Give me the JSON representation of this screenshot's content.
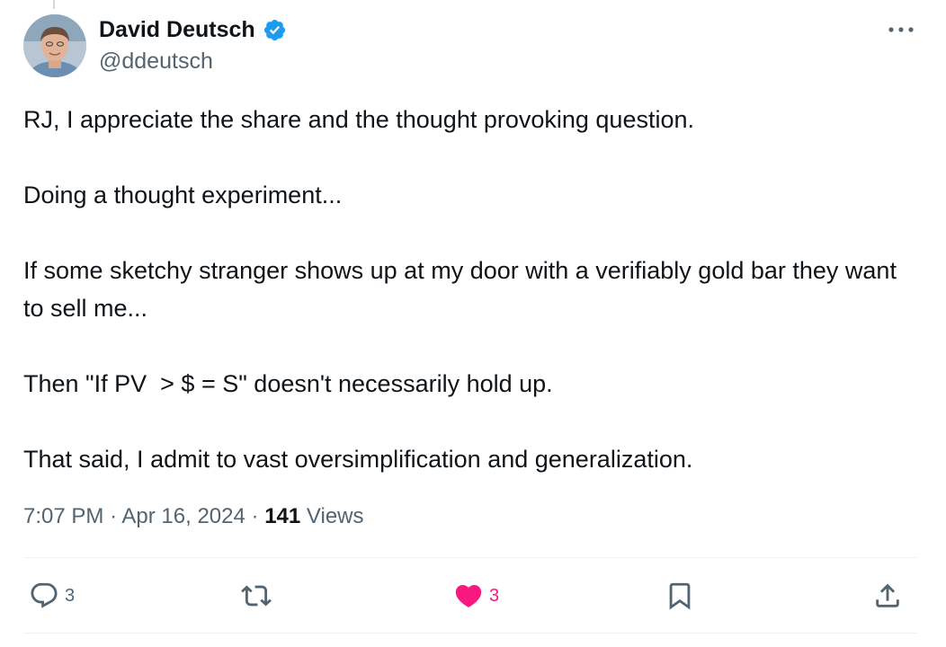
{
  "author": {
    "display_name": "David Deutsch",
    "handle": "@ddeutsch",
    "verified": true
  },
  "tweet": {
    "paragraphs": [
      "RJ, I appreciate the share and the thought provoking question.",
      "Doing a thought experiment...",
      "If some sketchy stranger shows up at my door with a verifiably gold bar they want to sell me...",
      "Then \"If PV  > $ = S\" doesn't necessarily hold up.",
      "That said, I admit to vast oversimplification and generalization."
    ],
    "time": "7:07 PM",
    "separator": "·",
    "date": "Apr 16, 2024",
    "views_count": "141",
    "views_label": "Views"
  },
  "actions": {
    "reply_count": "3",
    "retweet_count": "",
    "like_count": "3",
    "liked": true
  },
  "icons": {
    "verified": "verified-badge-icon",
    "more": "more-options-icon",
    "reply": "reply-icon",
    "retweet": "retweet-icon",
    "like": "heart-icon",
    "bookmark": "bookmark-icon",
    "share": "share-icon"
  },
  "colors": {
    "text_primary": "#0f1419",
    "text_secondary": "#536471",
    "verified_blue": "#1d9bf0",
    "like_pink": "#f91880",
    "divider": "#eff3f4"
  }
}
